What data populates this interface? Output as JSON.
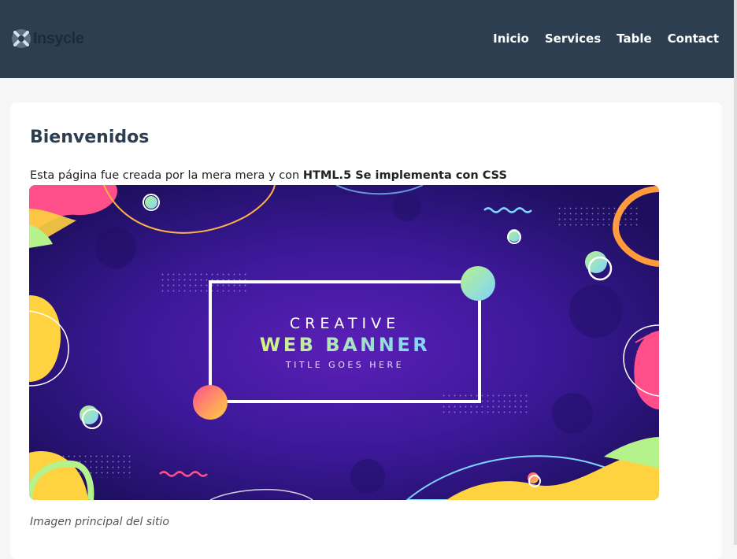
{
  "header": {
    "logo_text": "Insycle",
    "nav": [
      "Inicio",
      "Services",
      "Table",
      "Contact"
    ]
  },
  "main": {
    "title": "Bienvenidos",
    "intro_text": "Esta página fue creada por la mera mera y con ",
    "intro_bold": "HTML.5 Se implementa con CSS",
    "banner": {
      "line1": "CREATIVE",
      "line2": "WEB BANNER",
      "line3": "TITLE GOES HERE"
    },
    "caption": "Imagen principal del sitio"
  },
  "colors": {
    "header_bg": "#2c3e50",
    "banner_bg": "#3a1896",
    "accent_pink": "#ff4f8b",
    "accent_yellow": "#ffd23f",
    "accent_green": "#b6f28c"
  }
}
